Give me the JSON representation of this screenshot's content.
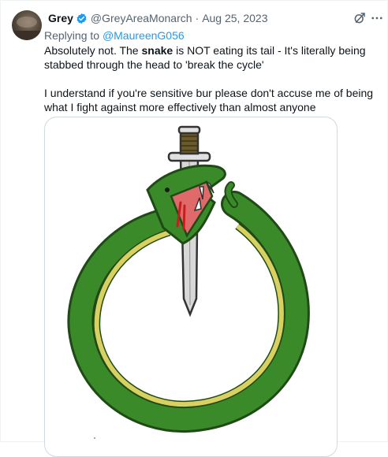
{
  "tweet": {
    "author_name": "Grey",
    "handle": "@GreyAreaMonarch",
    "separator": "·",
    "date": "Aug 25, 2023",
    "replying_prefix": "Replying to",
    "replying_to": "@MaureenG056",
    "paragraph1_pre": "Absolutely not. The ",
    "paragraph1_bold": "snake",
    "paragraph1_post": " is NOT eating its tail - It's literally being stabbed through the head to 'break the cycle'",
    "paragraph2": "I understand if you're sensitive bur please don't accuse me of being what I fight against more effectively than almost anyone"
  },
  "icons": {
    "verified": "verified-badge-icon",
    "grok": "grok-icon",
    "more": "more-icon"
  },
  "colors": {
    "link": "#1d9bf0",
    "secondary_text": "#536471",
    "snake_green": "#3a8a2a",
    "snake_belly": "#d8d060",
    "blade": "#d8d8d8",
    "blood": "#c41e1e"
  }
}
